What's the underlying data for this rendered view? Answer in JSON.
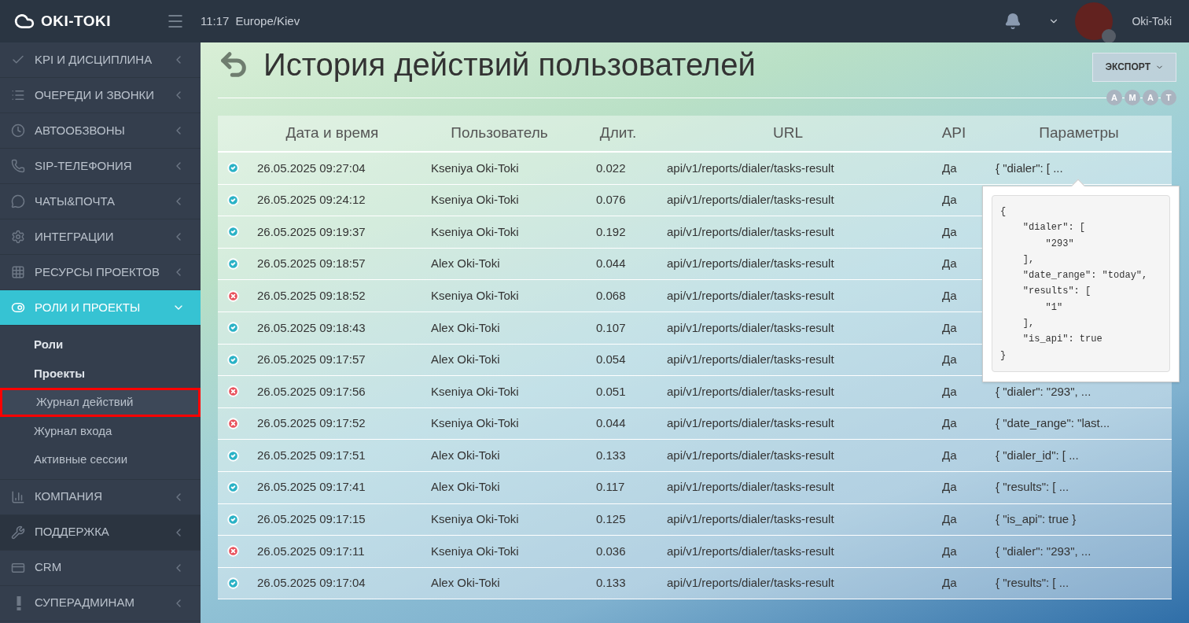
{
  "header": {
    "logo": "OKI-TOKI",
    "time": "11:17",
    "timezone": "Europe/Kiev",
    "user": "Oki-Toki"
  },
  "sidebar": {
    "items": [
      {
        "label": "KPI И ДИСЦИПЛИНА",
        "expanded": false,
        "hovered": false
      },
      {
        "label": "ОЧЕРЕДИ И ЗВОНКИ",
        "expanded": false,
        "hovered": false
      },
      {
        "label": "АВТООБЗВОНЫ",
        "expanded": false,
        "hovered": false
      },
      {
        "label": "SIP-ТЕЛЕФОНИЯ",
        "expanded": false,
        "hovered": false
      },
      {
        "label": "ЧАТЫ&ПОЧТА",
        "expanded": false,
        "hovered": false
      },
      {
        "label": "ИНТЕГРАЦИИ",
        "expanded": false,
        "hovered": false
      },
      {
        "label": "РЕСУРСЫ ПРОЕКТОВ",
        "expanded": false,
        "hovered": false
      },
      {
        "label": "РОЛИ И ПРОЕКТЫ",
        "expanded": true,
        "hovered": false,
        "children": [
          {
            "label": "Роли",
            "bold": true,
            "selected": false
          },
          {
            "label": "Проекты",
            "bold": true,
            "selected": false
          },
          {
            "label": "Журнал действий",
            "bold": false,
            "selected": true
          },
          {
            "label": "Журнал входа",
            "bold": false,
            "selected": false
          },
          {
            "label": "Активные сессии",
            "bold": false,
            "selected": false
          }
        ]
      },
      {
        "label": "КОМПАНИЯ",
        "expanded": false,
        "hovered": false
      },
      {
        "label": "ПОДДЕРЖКА",
        "expanded": false,
        "hovered": true
      },
      {
        "label": "CRM",
        "expanded": false,
        "hovered": false
      },
      {
        "label": "СУПЕРАДМИНАМ",
        "expanded": false,
        "hovered": false
      }
    ]
  },
  "page": {
    "title": "История действий пользователей",
    "export_button": "ЭКСПОРТ",
    "badges": [
      "A",
      "M",
      "A",
      "T"
    ]
  },
  "table": {
    "columns": [
      "Дата и время",
      "Пользователь",
      "Длит.",
      "URL",
      "API",
      "Параметры"
    ],
    "rows": [
      {
        "success": true,
        "date": "26.05.2025 09:27:04",
        "user": "Kseniya Oki-Toki",
        "duration": "0.022",
        "url": "api/v1/reports/dialer/tasks-result",
        "api": "Да",
        "params": "{ \"dialer\": [ ..."
      },
      {
        "success": true,
        "date": "26.05.2025 09:24:12",
        "user": "Kseniya Oki-Toki",
        "duration": "0.076",
        "url": "api/v1/reports/dialer/tasks-result",
        "api": "Да"
      },
      {
        "success": true,
        "date": "26.05.2025 09:19:37",
        "user": "Kseniya Oki-Toki",
        "duration": "0.192",
        "url": "api/v1/reports/dialer/tasks-result",
        "api": "Да"
      },
      {
        "success": true,
        "date": "26.05.2025 09:18:57",
        "user": "Alex Oki-Toki",
        "duration": "0.044",
        "url": "api/v1/reports/dialer/tasks-result",
        "api": "Да"
      },
      {
        "success": false,
        "date": "26.05.2025 09:18:52",
        "user": "Kseniya Oki-Toki",
        "duration": "0.068",
        "url": "api/v1/reports/dialer/tasks-result",
        "api": "Да"
      },
      {
        "success": true,
        "date": "26.05.2025 09:18:43",
        "user": "Alex Oki-Toki",
        "duration": "0.107",
        "url": "api/v1/reports/dialer/tasks-result",
        "api": "Да"
      },
      {
        "success": true,
        "date": "26.05.2025 09:17:57",
        "user": "Alex Oki-Toki",
        "duration": "0.054",
        "url": "api/v1/reports/dialer/tasks-result",
        "api": "Да"
      },
      {
        "success": false,
        "date": "26.05.2025 09:17:56",
        "user": "Kseniya Oki-Toki",
        "duration": "0.051",
        "url": "api/v1/reports/dialer/tasks-result",
        "api": "Да",
        "params": "{ \"dialer\": \"293\", ..."
      },
      {
        "success": false,
        "date": "26.05.2025 09:17:52",
        "user": "Kseniya Oki-Toki",
        "duration": "0.044",
        "url": "api/v1/reports/dialer/tasks-result",
        "api": "Да",
        "params": "{ \"date_range\": \"last..."
      },
      {
        "success": true,
        "date": "26.05.2025 09:17:51",
        "user": "Alex Oki-Toki",
        "duration": "0.133",
        "url": "api/v1/reports/dialer/tasks-result",
        "api": "Да",
        "params": "{ \"dialer_id\": [ ..."
      },
      {
        "success": true,
        "date": "26.05.2025 09:17:41",
        "user": "Alex Oki-Toki",
        "duration": "0.117",
        "url": "api/v1/reports/dialer/tasks-result",
        "api": "Да",
        "params": "{ \"results\": [ ..."
      },
      {
        "success": true,
        "date": "26.05.2025 09:17:15",
        "user": "Kseniya Oki-Toki",
        "duration": "0.125",
        "url": "api/v1/reports/dialer/tasks-result",
        "api": "Да",
        "params": "{ \"is_api\": true }"
      },
      {
        "success": false,
        "date": "26.05.2025 09:17:11",
        "user": "Kseniya Oki-Toki",
        "duration": "0.036",
        "url": "api/v1/reports/dialer/tasks-result",
        "api": "Да",
        "params": "{ \"dialer\": \"293\", ..."
      },
      {
        "success": true,
        "date": "26.05.2025 09:17:04",
        "user": "Alex Oki-Toki",
        "duration": "0.133",
        "url": "api/v1/reports/dialer/tasks-result",
        "api": "Да",
        "params": "{ \"results\": [ ..."
      }
    ]
  },
  "popover": {
    "code": "{\n    \"dialer\": [\n        \"293\"\n    ],\n    \"date_range\": \"today\",\n    \"results\": [\n        \"1\"\n    ],\n    \"is_api\": true\n}"
  }
}
